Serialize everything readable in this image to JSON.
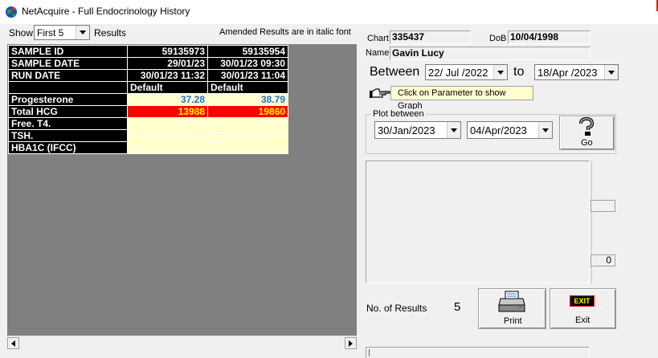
{
  "window": {
    "title": "NetAcquire - Full Endocrinology History"
  },
  "toolbar": {
    "show_label": "Show",
    "show_value": "First 5",
    "results_label": "Results",
    "amended_note": "Amended  Results are in italic font"
  },
  "grid": {
    "rows": [
      {
        "label": "SAMPLE ID",
        "col1": "59135973",
        "col2": "59135954"
      },
      {
        "label": "SAMPLE DATE",
        "col1": "29/01/23",
        "col2": "30/01/23 09:30"
      },
      {
        "label": "RUN DATE",
        "col1": "30/01/23 11:32",
        "col2": "30/01/23 11:04"
      },
      {
        "label": "",
        "col1": "Default",
        "col2": "Default"
      },
      {
        "label": "Progesterone",
        "col1": "37.28",
        "col2": "38.79"
      },
      {
        "label": "Total HCG",
        "col1": "13988",
        "col2": "19860"
      },
      {
        "label": "Free. T4.",
        "col1": "",
        "col2": ""
      },
      {
        "label": "TSH.",
        "col1": "",
        "col2": ""
      },
      {
        "label": "HBA1C (IFCC)",
        "col1": "",
        "col2": ""
      }
    ],
    "colors": {
      "header_bg": "#000000",
      "cream": "#ffffd0",
      "alert_bg": "#ff0000",
      "alert_text": "#ffff00",
      "value_blue": "#1e73c8"
    }
  },
  "patient": {
    "chart_label": "Chart",
    "chart_value": "335437",
    "dob_label": "DoB",
    "dob_value": "10/04/1998",
    "name_label": "Name",
    "name_value": "Gavin Lucy"
  },
  "range": {
    "between_label": "Between",
    "from_value": "22/ Jul /2022",
    "to_label": "to",
    "to_value": "18/Apr /2023",
    "hint": "Click on Parameter to show Graph"
  },
  "plot": {
    "legend": "Plot between",
    "from_value": "30/Jan/2023",
    "to_value": "04/Apr/2023",
    "go_label": "Go",
    "min_value": "0"
  },
  "summary": {
    "results_label": "No. of Results",
    "results_count": "5",
    "print_label": "Print",
    "exit_badge": "EXIT",
    "exit_label": "Exit"
  }
}
